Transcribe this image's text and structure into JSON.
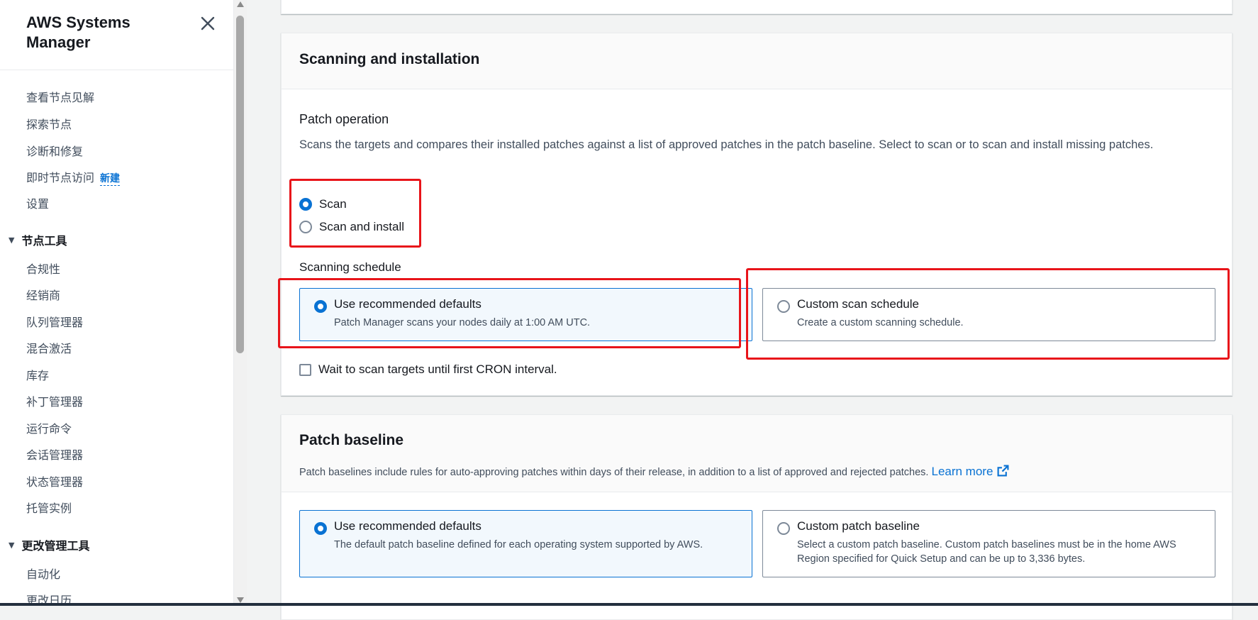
{
  "sidebar": {
    "title": "AWS Systems Manager",
    "items_top": [
      {
        "label": "查看节点见解"
      },
      {
        "label": "探索节点"
      },
      {
        "label": "诊断和修复"
      },
      {
        "label": "即时节点访问",
        "badge": "新建"
      },
      {
        "label": "设置"
      }
    ],
    "section_node_tools": {
      "label": "节点工具",
      "items": [
        "合规性",
        "经销商",
        "队列管理器",
        "混合激活",
        "库存",
        "补丁管理器",
        "运行命令",
        "会话管理器",
        "状态管理器",
        "托管实例"
      ]
    },
    "section_change_tools": {
      "label": "更改管理工具",
      "items": [
        "自动化",
        "更改日历"
      ]
    }
  },
  "scanning": {
    "title": "Scanning and installation",
    "patch_operation": {
      "label": "Patch operation",
      "description": "Scans the targets and compares their installed patches against a list of approved patches in the patch baseline. Select to scan or to scan and install missing patches.",
      "options": [
        "Scan",
        "Scan and install"
      ],
      "selected": "Scan"
    },
    "schedule": {
      "label": "Scanning schedule",
      "tiles": [
        {
          "title": "Use recommended defaults",
          "description": "Patch Manager scans your nodes daily at 1:00 AM UTC."
        },
        {
          "title": "Custom scan schedule",
          "description": "Create a custom scanning schedule."
        }
      ],
      "selected": "Use recommended defaults"
    },
    "wait_checkbox": {
      "label": "Wait to scan targets until first CRON interval.",
      "checked": false
    }
  },
  "baseline": {
    "title": "Patch baseline",
    "description": "Patch baselines include rules for auto-approving patches within days of their release, in addition to a list of approved and rejected patches.",
    "learn_more": "Learn more",
    "tiles": [
      {
        "title": "Use recommended defaults",
        "description": "The default patch baseline defined for each operating system supported by AWS."
      },
      {
        "title": "Custom patch baseline",
        "description": "Select a custom patch baseline. Custom patch baselines must be in the home AWS Region specified for Quick Setup and can be up to 3,336 bytes."
      }
    ],
    "selected": "Use recommended defaults"
  },
  "colors": {
    "accent": "#0972d3",
    "highlight": "#e8141a"
  },
  "icons": [
    "close-icon",
    "triangle-down-icon",
    "external-link-icon"
  ]
}
